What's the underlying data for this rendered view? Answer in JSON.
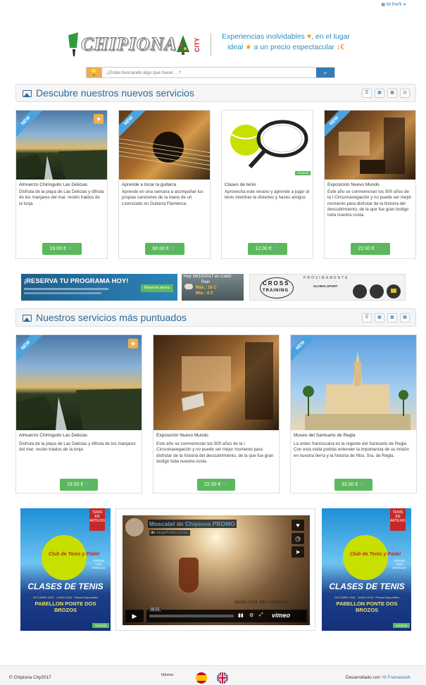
{
  "nav": {
    "profile": "Mi Perfil"
  },
  "logo": {
    "text": "CHIPIONA",
    "city": "CITY"
  },
  "tagline": {
    "line1": "Experiencias inolvidables",
    "line1b": ", en el lugar",
    "line2": "ideal",
    "line2b": " a un precio espectacular"
  },
  "search": {
    "placeholder": "¿Estás buscando algo que hacer ...?"
  },
  "section1": {
    "title": "Descubre nuestros nuevos servicios",
    "cards": [
      {
        "ribbon": "NEW",
        "title": "Almuerzo Chiringuito Las Delicias",
        "desc": "Disfruta de la playa de Las Delicias y difruta de los manjares del mar. recién traidos de la lonja",
        "price": "19.00 €"
      },
      {
        "ribbon": "NEW",
        "title": "Aprende a tocar la guitarra",
        "desc": "Aprende en una semana a acompañar tus propias canciones de la mano de un Licenciado en Guitarra Flamenca.",
        "price": "60.00 €"
      },
      {
        "ribbon": "",
        "title": "Clases de tenis",
        "desc": "Aprovecha este verano y aprende a jugar al tenis mientras te diviertes y haces amigos",
        "price": "12.00 €",
        "anuncio": "Anuncio"
      },
      {
        "ribbon": "NEW",
        "title": "Exposición Nuevo Mundo",
        "desc": "Este año se conmemoran los 500 años de la I Circunnavegación y no puede ser mejor momento para disfrutar de la historia del descubrimiento, de la que fue gran testigo toda nuestra costa.",
        "price": "22.00 €"
      }
    ]
  },
  "banners": {
    "reserva": "¡RESERVA TU PROGRAMA HOY!",
    "reserva_btn": "Reserva ahora",
    "weather": {
      "date": "Hoy 16/10/2017 en Cádiz",
      "cond": "Rain",
      "max": "Máx.: 16 C",
      "min": "Mín.: 4 C"
    },
    "cross_proximamente": "PRÓXIMAMENTE",
    "cross_title": "CROSS",
    "cross_sub": "TRAINING",
    "cross_brand": "GLOBALSPORT"
  },
  "section2": {
    "title": "Nuestros servicios más puntuados",
    "cards": [
      {
        "ribbon": "NEW",
        "title": "Almuerzo Chiringuito Las Delicias",
        "desc": "Disfruta de la playa de Las Delicias y difruta de los manjares del mar. recién traidos de la lonja",
        "price": "19.00 €"
      },
      {
        "ribbon": "",
        "title": "Exposición Nuevo Mundo",
        "desc": "Este año se conmemoran los 500 años de la I Circunnavegación y no puede ser mejor momento para disfrutar de la historia del descubrimiento, de la que fue gran testigo toda nuestra costa.",
        "price": "22.00 €"
      },
      {
        "ribbon": "NEW",
        "title": "Museo del Santuario de Regla",
        "desc": "La orden franciscana es la regente del Santuario de Regla. Con esta visita podrás entender la importancia de su misión en nuestra tierra y la historia de Ntra. Sra. de Regla.",
        "price": "33.00 €"
      }
    ]
  },
  "poster": {
    "tenis": "TENIS EN ARTEXIO",
    "club": "Club de Tenis y Pádel",
    "todos": "TODOS LOS NIVELES",
    "clases": "CLASES DE TENIS",
    "dates": "OCTUBRE 2016 - JUNIO 2018 · Plazas Disponibles",
    "pabellon": "PABELLON PONTE DOS BROZOS",
    "anuncio": "Anuncio"
  },
  "video": {
    "title": "Moscatel de Chipiona PROMO",
    "by": "de",
    "author": "JasjaProducciones",
    "time": "02:21",
    "brand": "MOSCATEL DE CHIPIONA",
    "vimeo": "vimeo"
  },
  "footer": {
    "copy": "© Chipiona City2017",
    "idioma": "Idioma:",
    "dev": "Desarrollado con ",
    "framework": "Yii Framework"
  },
  "colors": {
    "accent": "#2a6a9e",
    "price": "#5cb85c",
    "ribbon": "#4aa3df",
    "tagline": "#2a8fc4"
  }
}
